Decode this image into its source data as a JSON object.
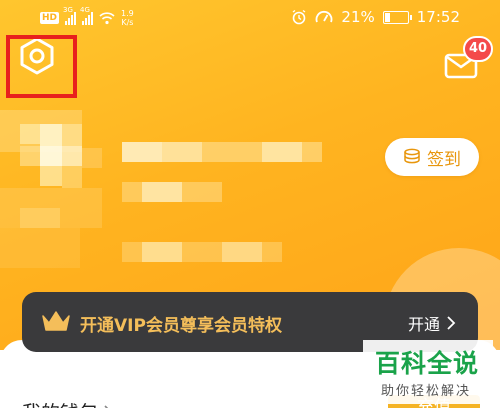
{
  "status_bar": {
    "hd": "HD",
    "net1": "3G",
    "net2": "4G",
    "speed_value": "1.9",
    "speed_unit": "K/s",
    "battery_percent": "21%",
    "battery_level": 0.21,
    "time": "17:52"
  },
  "header": {
    "settings_icon": "settings-hexagon-icon",
    "mail_icon": "envelope-icon",
    "mail_badge": "40",
    "signin_label": "签到",
    "signin_icon": "coin-stack-icon"
  },
  "vip": {
    "text": "开通VIP会员尊享会员特权",
    "open_label": "开通",
    "crown_icon": "crown-icon"
  },
  "wallet": {
    "label": "我的钱包",
    "recharge_label": "充值"
  },
  "watermark": {
    "title": "百科全说",
    "subtitle": "助你轻松解决"
  },
  "colors": {
    "brand_orange": "#ffb420",
    "vip_gold": "#f4be5a",
    "vip_dark": "#3a3a3c",
    "badge_red": "#f44a4a",
    "highlight_red": "#e8201d"
  }
}
